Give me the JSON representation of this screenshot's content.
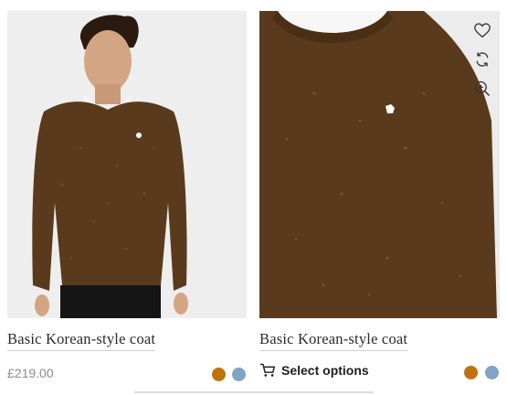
{
  "products": [
    {
      "title": "Basic Korean-style coat",
      "price": "£219.00",
      "swatches": [
        "#c0720e",
        "#7fa4c4"
      ]
    },
    {
      "title": "Basic Korean-style coat",
      "action_label": "Select options",
      "swatches": [
        "#c0720e",
        "#7fa4c4"
      ],
      "quick_actions": [
        "heart-icon",
        "compare-icon",
        "zoom-in-icon"
      ]
    }
  ]
}
